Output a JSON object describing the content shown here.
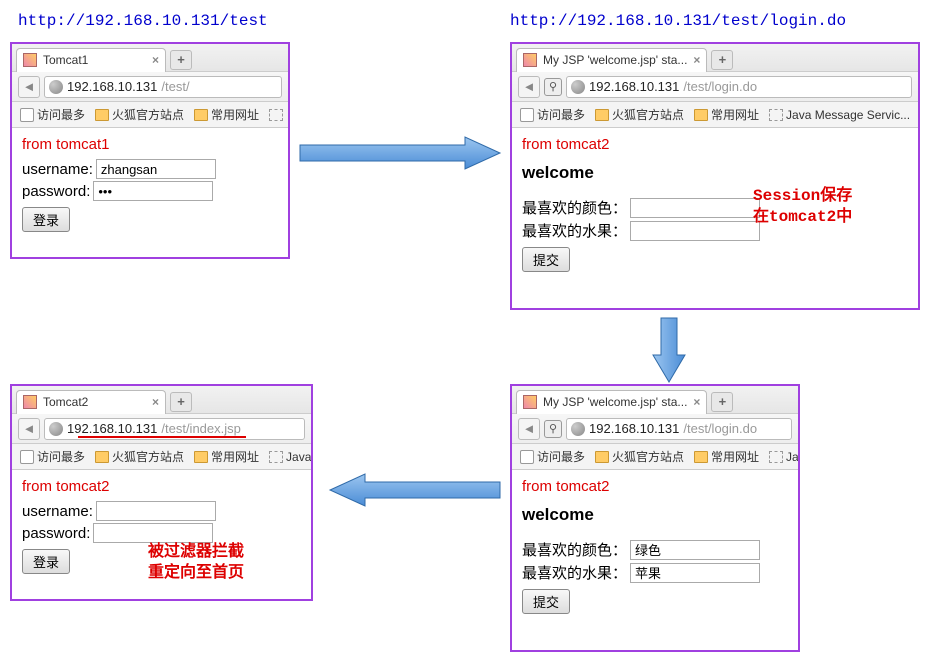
{
  "url_labels": {
    "left": "http://192.168.10.131/test",
    "right": "http://192.168.10.131/test/login.do"
  },
  "bookmarks": {
    "most_visited": "访问最多",
    "firefox_official": "火狐官方站点",
    "common_urls": "常用网址",
    "jms": "Java Message Servic...",
    "jms_short": "Java",
    "ja_short": "Ja"
  },
  "win1": {
    "tab_title": "Tomcat1",
    "url_host": "192.168.10.131",
    "url_path": "/test/",
    "from": "from tomcat1",
    "username_label": "username:",
    "username_value": "zhangsan",
    "password_label": "password:",
    "password_value": "•••",
    "login_btn": "登录"
  },
  "win2": {
    "tab_title": "My JSP 'welcome.jsp' sta...",
    "url_host": "192.168.10.131",
    "url_path": "/test/login.do",
    "from": "from tomcat2",
    "welcome": "welcome",
    "fav_color_label": "最喜欢的颜色：",
    "fav_color_value": "",
    "fav_fruit_label": "最喜欢的水果：",
    "fav_fruit_value": "",
    "submit_btn": "提交"
  },
  "win3": {
    "tab_title": "My JSP 'welcome.jsp' sta...",
    "url_host": "192.168.10.131",
    "url_path": "/test/login.do",
    "from": "from tomcat2",
    "welcome": "welcome",
    "fav_color_label": "最喜欢的颜色：",
    "fav_color_value": "绿色",
    "fav_fruit_label": "最喜欢的水果：",
    "fav_fruit_value": "苹果",
    "submit_btn": "提交"
  },
  "win4": {
    "tab_title": "Tomcat2",
    "url_host": "192.168.10.131",
    "url_path": "/test/index.jsp",
    "from": "from tomcat2",
    "username_label": "username:",
    "username_value": "",
    "password_label": "password:",
    "password_value": "",
    "login_btn": "登录"
  },
  "annotations": {
    "session_saved_l1": "Session保存",
    "session_saved_l2": "在tomcat2中",
    "filter_l1": "被过滤器拦截",
    "filter_l2": "重定向至首页"
  }
}
